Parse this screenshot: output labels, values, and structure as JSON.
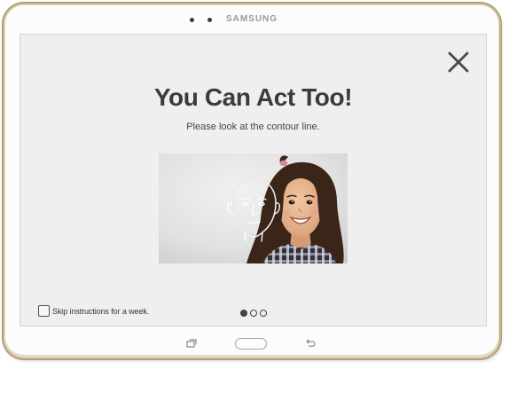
{
  "device": {
    "brand": "SAMSUNG",
    "frame_color": "#c6b290"
  },
  "dialog": {
    "title": "You Can Act Too!",
    "subtitle": "Please look at the contour line.",
    "close_icon": "close-icon",
    "photo": {
      "overlay_icon": "face-contour-icon",
      "overlay_color": "#ffffff"
    },
    "skip_checkbox": {
      "label": "Skip instructions for a week.",
      "checked": false
    },
    "pagination": {
      "total": 3,
      "current": 1
    }
  },
  "nav_bar": {
    "recent_apps_icon": "recent-apps-icon",
    "home_icon": "home-button-icon",
    "back_icon": "back-icon"
  },
  "colors": {
    "screen_background": "#efefef",
    "text_primary": "#3b3b3b",
    "indicator": "#444444"
  }
}
